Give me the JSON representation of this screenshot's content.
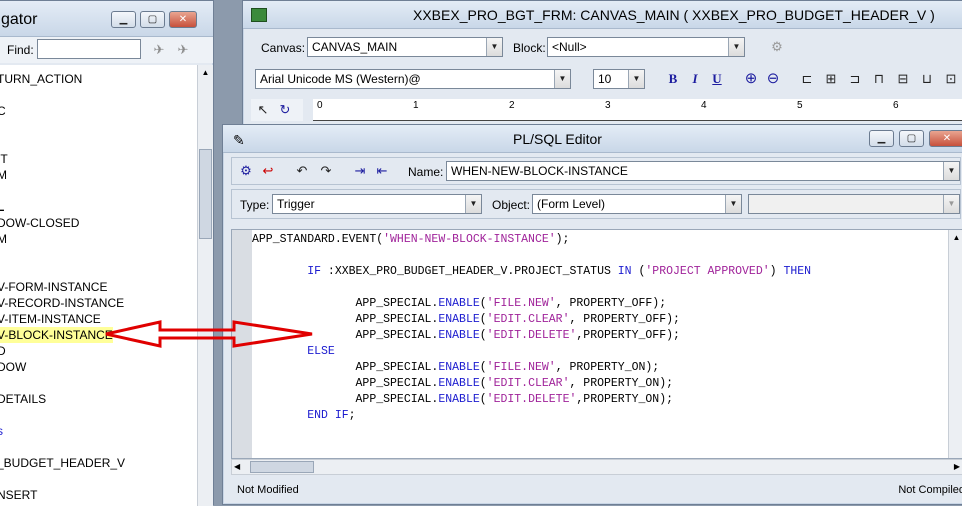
{
  "navigator": {
    "title": "gator",
    "find_label": "Find:",
    "items": [
      {
        "label": "TURN_ACTION"
      },
      {
        "label": "C"
      },
      {
        "label": "IT"
      },
      {
        "label": "M"
      },
      {
        "label": "L"
      },
      {
        "label": "DOW-CLOSED"
      },
      {
        "label": "M"
      },
      {
        "label": "V-FORM-INSTANCE"
      },
      {
        "label": "V-RECORD-INSTANCE"
      },
      {
        "label": "V-ITEM-INSTANCE"
      },
      {
        "label": "V-BLOCK-INSTANCE"
      },
      {
        "label": "D"
      },
      {
        "label": "DOW"
      },
      {
        "label": "DETAILS"
      },
      {
        "label": "s"
      },
      {
        "label": "_BUDGET_HEADER_V"
      },
      {
        "label": "NSERT"
      }
    ]
  },
  "canvas_window": {
    "title": "XXBEX_PRO_BGT_FRM: CANVAS_MAIN ( XXBEX_PRO_BUDGET_HEADER_V )",
    "canvas_label": "Canvas:",
    "canvas_value": "CANVAS_MAIN",
    "block_label": "Block:",
    "block_value": "<Null>",
    "font_value": "Arial Unicode MS (Western)@",
    "size_value": "10",
    "bold": "B",
    "italic": "I",
    "underline": "U",
    "ruler": [
      "0",
      "1",
      "2",
      "3",
      "4",
      "5",
      "6"
    ]
  },
  "plsql_editor": {
    "title": "PL/SQL Editor",
    "name_label": "Name:",
    "name_value": "WHEN-NEW-BLOCK-INSTANCE",
    "type_label": "Type:",
    "type_value": "Trigger",
    "object_label": "Object:",
    "object_value": "(Form Level)",
    "code": [
      {
        "text": "APP_STANDARD.EVENT('WHEN-NEW-BLOCK-INSTANCE');"
      },
      {
        "text": ""
      },
      {
        "text": "        IF :XXBEX_PRO_BUDGET_HEADER_V.PROJECT_STATUS IN ('PROJECT APPROVED') THEN"
      },
      {
        "text": ""
      },
      {
        "text": "               APP_SPECIAL.ENABLE('FILE.NEW', PROPERTY_OFF);"
      },
      {
        "text": "               APP_SPECIAL.ENABLE('EDIT.CLEAR', PROPERTY_OFF);"
      },
      {
        "text": "               APP_SPECIAL.ENABLE('EDIT.DELETE',PROPERTY_OFF);"
      },
      {
        "text": "        ELSE"
      },
      {
        "text": "               APP_SPECIAL.ENABLE('FILE.NEW', PROPERTY_ON);"
      },
      {
        "text": "               APP_SPECIAL.ENABLE('EDIT.CLEAR', PROPERTY_ON);"
      },
      {
        "text": "               APP_SPECIAL.ENABLE('EDIT.DELETE',PROPERTY_ON);"
      },
      {
        "text": "        END IF;"
      }
    ],
    "status_left": "Not Modified",
    "status_right": "Not Compiled"
  },
  "colors": {
    "highlight": "#ffff99",
    "keyword": "#1c1ccf",
    "string": "#a0239a",
    "arrow": "#e00000"
  }
}
